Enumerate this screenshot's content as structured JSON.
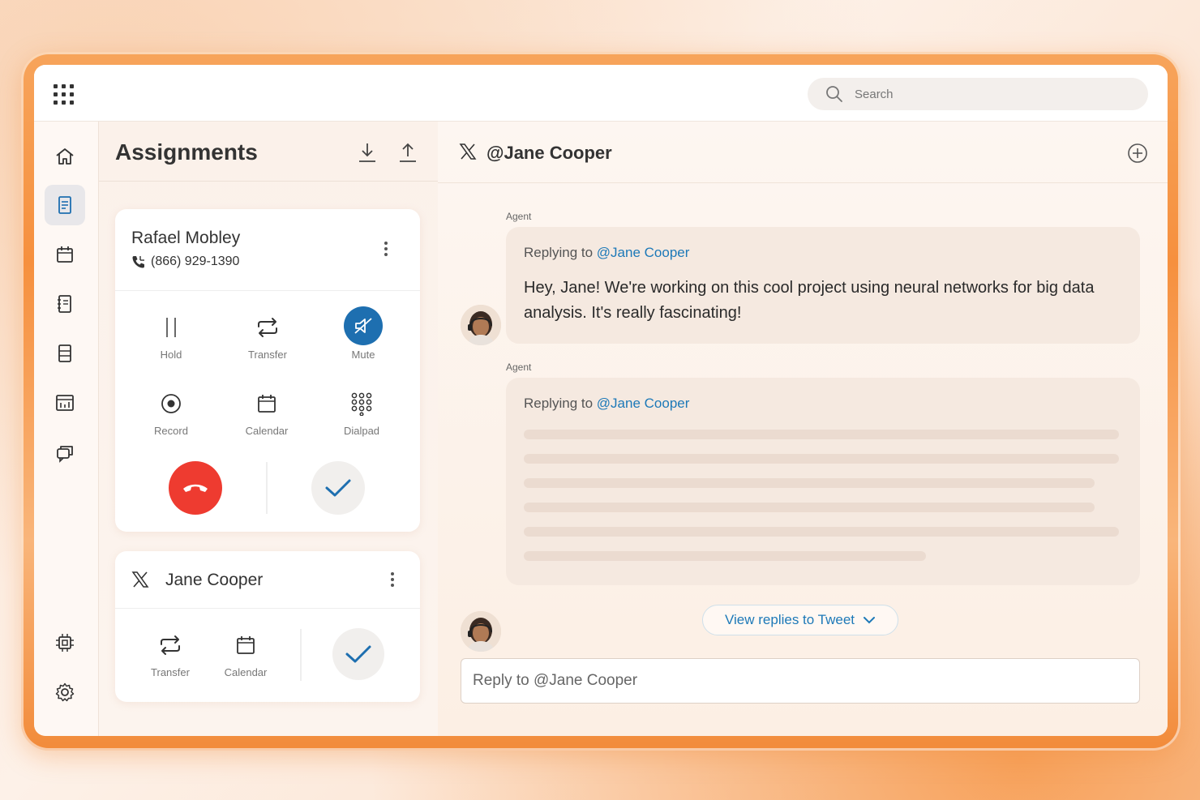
{
  "topbar": {
    "search_placeholder": "Search"
  },
  "sidebar": {
    "items": [
      {
        "name": "home",
        "icon": "home-icon"
      },
      {
        "name": "assignments",
        "icon": "document-icon",
        "active": true
      },
      {
        "name": "calendar",
        "icon": "calendar-icon"
      },
      {
        "name": "notebook",
        "icon": "notebook-icon"
      },
      {
        "name": "records",
        "icon": "list-icon"
      },
      {
        "name": "reports",
        "icon": "chart-icon"
      },
      {
        "name": "conversations",
        "icon": "chat-icon"
      }
    ],
    "bottom_items": [
      {
        "name": "integrations",
        "icon": "chip-icon"
      },
      {
        "name": "settings",
        "icon": "gear-icon"
      }
    ]
  },
  "assignments": {
    "title": "Assignments",
    "call_card": {
      "name": "Rafael Mobley",
      "phone": "(866) 929-1390",
      "actions": [
        "Hold",
        "Transfer",
        "Mute",
        "Record",
        "Calendar",
        "Dialpad"
      ]
    },
    "social_card": {
      "name": "Jane Cooper",
      "actions": [
        "Transfer",
        "Calendar"
      ]
    }
  },
  "chat": {
    "title": "@Jane Cooper",
    "messages": [
      {
        "sender": "Agent",
        "replying_prefix": "Replying to",
        "replying_handle": "@Jane Cooper",
        "text": "Hey, Jane! We're working on this cool project using neural networks for big data analysis. It's really fascinating!"
      },
      {
        "sender": "Agent",
        "replying_prefix": "Replying to",
        "replying_handle": "@Jane Cooper",
        "text": ""
      }
    ],
    "view_replies_label": "View replies to Tweet",
    "reply_placeholder": "Reply to @Jane Cooper"
  },
  "colors": {
    "accent_blue": "#1d79b8",
    "mute_active": "#1e6fb0",
    "end_call_red": "#ee3b30",
    "frame_orange": "#f6903e"
  }
}
